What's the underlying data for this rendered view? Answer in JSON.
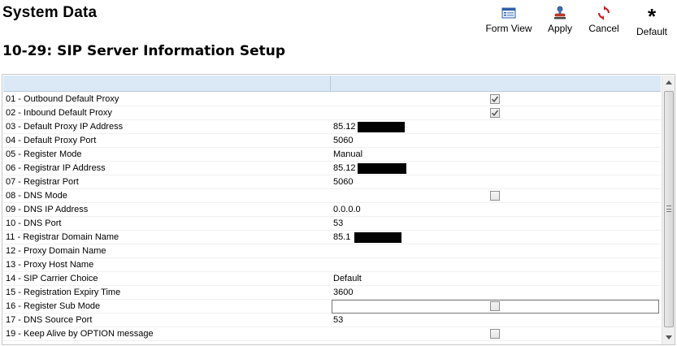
{
  "header": {
    "app_title": "System Data",
    "page_title": "10-29: SIP Server Information Setup"
  },
  "toolbar": {
    "form_view": "Form View",
    "apply": "Apply",
    "cancel": "Cancel",
    "default": "Default",
    "default_glyph": "*"
  },
  "grid": {
    "columns": [
      "",
      ""
    ],
    "rows": [
      {
        "name": "01 - Outbound Default Proxy",
        "value": "",
        "checkbox": true,
        "checked": true
      },
      {
        "name": "02 - Inbound Default Proxy",
        "value": "",
        "checkbox": true,
        "checked": true
      },
      {
        "name": "03 - Default Proxy IP Address",
        "value": "85.12",
        "redacted": true
      },
      {
        "name": "04 - Default Proxy Port",
        "value": "5060"
      },
      {
        "name": "05 - Register Mode",
        "value": "Manual"
      },
      {
        "name": "06 - Registrar IP Address",
        "value": "85.12",
        "redacted": true
      },
      {
        "name": "07 - Registrar Port",
        "value": "5060"
      },
      {
        "name": "08 - DNS Mode",
        "value": "",
        "checkbox": true,
        "checked": false
      },
      {
        "name": "09 - DNS IP Address",
        "value": "0.0.0.0"
      },
      {
        "name": "10 - DNS Port",
        "value": "53"
      },
      {
        "name": "11 - Registrar Domain Name",
        "value": "85.1",
        "redacted": true
      },
      {
        "name": "12 - Proxy Domain Name",
        "value": ""
      },
      {
        "name": "13 - Proxy Host Name",
        "value": ""
      },
      {
        "name": "14 - SIP Carrier Choice",
        "value": "Default"
      },
      {
        "name": "15 - Registration Expiry Time",
        "value": "3600"
      },
      {
        "name": "16 - Register Sub Mode",
        "value": "",
        "checkbox": true,
        "checked": false,
        "editing": true
      },
      {
        "name": "17 - DNS Source Port",
        "value": "53"
      },
      {
        "name": "19 - Keep Alive by OPTION message",
        "value": "",
        "checkbox": true,
        "checked": false
      }
    ]
  },
  "colors": {
    "header_bg": "#dbe8f6",
    "redaction": "#000000",
    "cancel_red": "#d0141a"
  }
}
